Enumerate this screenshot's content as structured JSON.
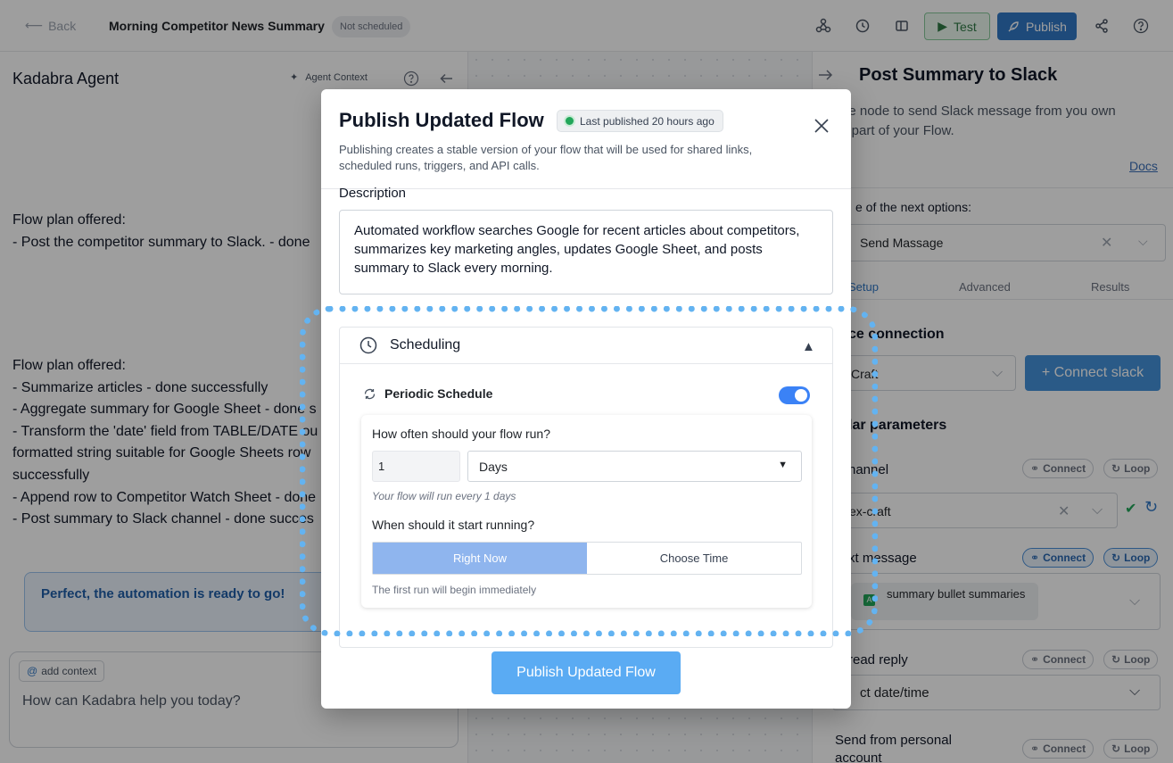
{
  "topbar": {
    "back_label": "Back",
    "flow_title": "Morning Competitor News Summary",
    "schedule_badge": "Not scheduled",
    "test_label": "Test",
    "publish_label": "Publish",
    "icons": [
      "webhook-icon",
      "history-icon",
      "layout-icon",
      "share-icon",
      "help-icon"
    ]
  },
  "left_panel": {
    "title": "Kadabra Agent",
    "agent_context_label": "Agent Context",
    "plan1": [
      "Flow plan offered:",
      "- Post the competitor summary to Slack. - done"
    ],
    "plan2": [
      "Flow plan offered:",
      "- Summarize articles - done successfully",
      "- Aggregate summary for Google Sheet - done s",
      "- Transform the 'date' field from TABLE/DATE ou",
      "formatted string suitable for Google Sheets row",
      "successfully",
      "- Append row to Competitor Watch Sheet - done",
      "- Post summary to Slack channel - done succes"
    ],
    "ready_message": "Perfect, the automation is ready to go!",
    "add_context_label": "add context",
    "input_placeholder": "How can Kadabra help you today?"
  },
  "right_panel": {
    "title": "Post Summary to Slack",
    "description": [
      "he node to send Slack message from you own",
      "s part of your Flow."
    ],
    "docs_label": "Docs",
    "options_label": "e of the next options:",
    "action_value": "Send Massage",
    "tabs": [
      "Setup",
      "Advanced",
      "Results"
    ],
    "connection_heading": "ce connection",
    "connection_value": "Craft",
    "connect_slack_label": "+ Connect slack",
    "params_heading": "lar parameters",
    "channel_label": "hannel",
    "channel_value": "ex-craft",
    "text_message_label": "xt message",
    "token_label": "summary bullet summaries",
    "thread_reply_label": "read reply",
    "date_value": "ct date/time",
    "personal_label": "Send from personal account",
    "connect_label": "Connect",
    "loop_label": "Loop"
  },
  "modal": {
    "title": "Publish Updated Flow",
    "last_published": "Last published 20 hours ago",
    "subtitle": "Publishing creates a stable version of your flow that will be used for shared links, scheduled runs, triggers, and API calls.",
    "description_label": "Description",
    "description_value": "Automated workflow searches Google for recent articles about competitors, summarizes key marketing angles, updates Google Sheet, and posts summary to Slack every morning.",
    "scheduling": {
      "title": "Scheduling",
      "periodic_label": "Periodic Schedule",
      "periodic_enabled": true,
      "frequency_question": "How often should your flow run?",
      "interval_value": "1",
      "interval_unit": "Days",
      "run_note": "Your flow will run every 1 days",
      "start_question": "When should it start running?",
      "start_options": [
        "Right Now",
        "Choose Time"
      ],
      "start_selected": "Right Now",
      "first_run_note": "The first run will begin immediately"
    },
    "publish_button": "Publish Updated Flow"
  },
  "colors": {
    "accent": "#3178c6",
    "highlight": "#63b3f1",
    "publish_button": "#5aabf3",
    "status_green": "#22a65a"
  }
}
